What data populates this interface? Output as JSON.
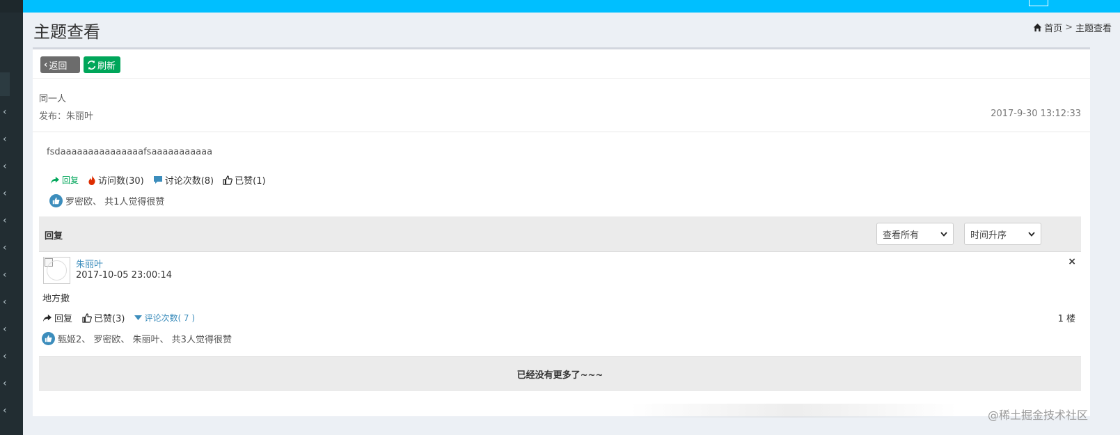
{
  "header": {
    "title": "主题查看",
    "breadcrumb": {
      "home": "首页",
      "separator": ">",
      "current": "主题查看"
    }
  },
  "toolbar": {
    "back_label": "返回",
    "refresh_label": "刷新"
  },
  "post": {
    "title": "同一人",
    "author_prefix": "发布：",
    "author": "朱丽叶",
    "time": "2017-9-30 13:12:33",
    "body": "fsdaaaaaaaaaaaaaaafsaaaaaaaaaaa",
    "actions": {
      "reply": "回复",
      "views": "访问数(30)",
      "discussions": "讨论次数(8)",
      "liked": "已赞(1)"
    },
    "likers": "罗密欧、 共1人觉得很赞"
  },
  "replies_section": {
    "title": "回复",
    "view_filter": "查看所有",
    "order_filter": "时间升序",
    "items": [
      {
        "user": "朱丽叶",
        "time": "2017-10-05 23:00:14",
        "content": "地方撒",
        "reply_label": "回复",
        "liked_label": "已赞(3)",
        "comments_label": "评论次数( 7 )",
        "floor": "1 楼",
        "likers": "甄姬2、 罗密欧、 朱丽叶、 共3人觉得很赞",
        "close": "×"
      }
    ],
    "no_more": "已经没有更多了~~~"
  },
  "watermark": "@稀土掘金技术社区",
  "colors": {
    "topbar": "#00bfff",
    "sidebar": "#222d32",
    "back_button": "#6c6c6c",
    "refresh_button": "#00a65a",
    "link": "#3c8dbc",
    "like_badge": "#3c8dbc",
    "fire": "#dd2c00"
  }
}
